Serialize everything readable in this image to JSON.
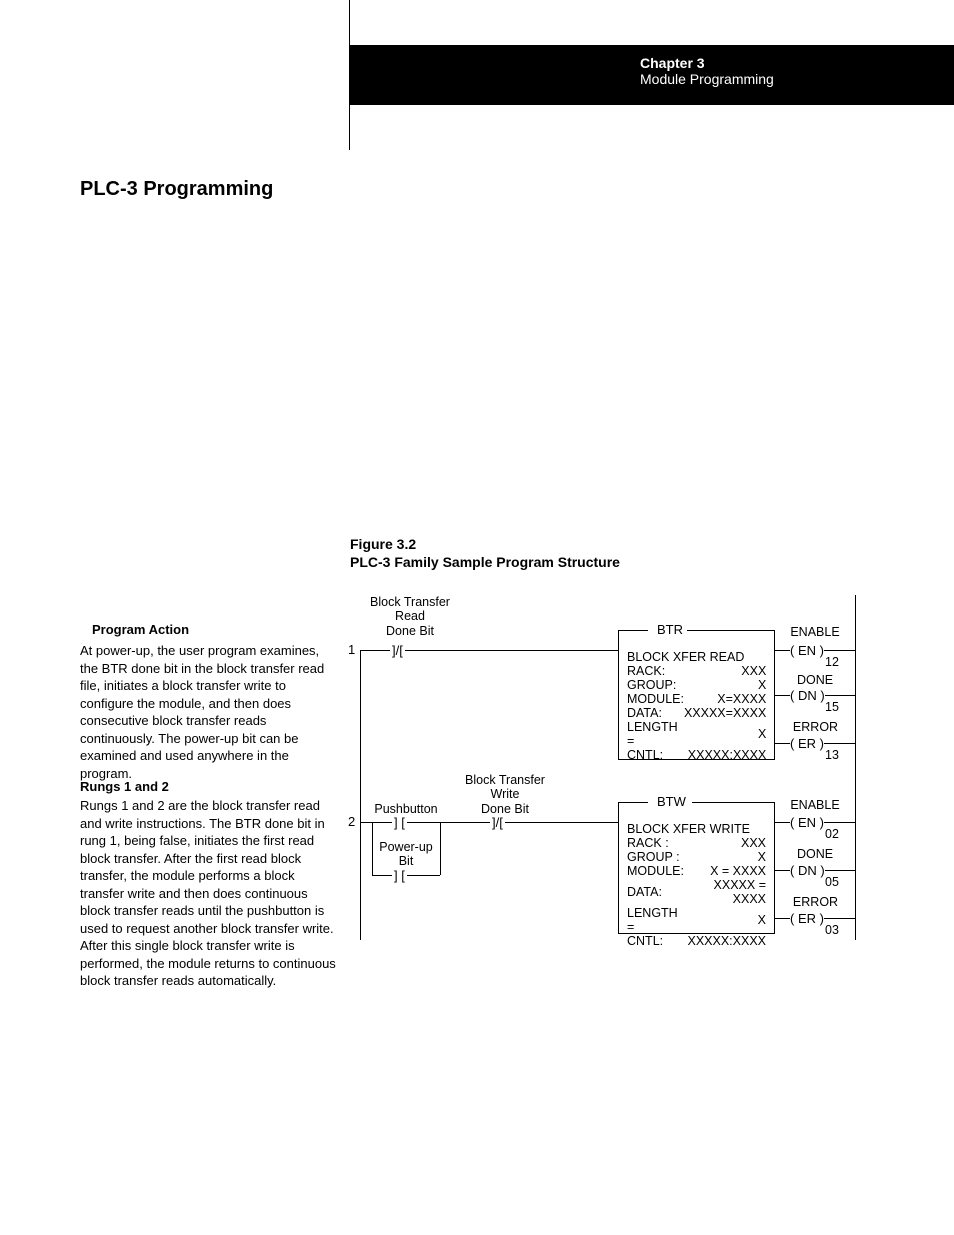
{
  "header": {
    "chapter": "Chapter 3",
    "subtitle": "Module Programming"
  },
  "heading": "PLC-3 Programming",
  "figure": {
    "num": "Figure 3.2",
    "title": "PLC-3 Family Sample Program Structure"
  },
  "left": {
    "h1": "Program Action",
    "p1": "At power-up, the user program examines, the BTR done bit in the block transfer read file, initiates a block transfer write to configure the module, and then does consecutive block transfer reads continuously.  The power-up bit can be examined and used anywhere in the program.",
    "h2": "Rungs 1 and 2",
    "p2": "Rungs 1 and 2 are the block transfer read and write instructions. The BTR done bit in rung 1, being false, initiates the first read block transfer. After the first read block transfer, the module performs a block transfer write and then does continuous block transfer reads until the pushbutton is used to request another block transfer write. After this single block transfer write is performed, the module returns to continuous block transfer reads automatically."
  },
  "ladder": {
    "rung1": {
      "num": "1",
      "contact1": "Block Transfer\nRead\nDone Bit",
      "boxTitle": "BTR",
      "boxH": "BLOCK XFER READ",
      "rows": [
        [
          "RACK:",
          "XXX"
        ],
        [
          "GROUP:",
          "X"
        ],
        [
          "MODULE:",
          "X=XXXX"
        ],
        [
          "DATA:",
          "XXXXX=XXXX"
        ],
        [
          "LENGTH  =",
          "X"
        ],
        [
          "CNTL:",
          "XXXXX:XXXX"
        ]
      ],
      "out": [
        [
          "ENABLE",
          "EN",
          "12"
        ],
        [
          "DONE",
          "DN",
          "15"
        ],
        [
          "ERROR",
          "ER",
          "13"
        ]
      ]
    },
    "rung2": {
      "num": "2",
      "pushbutton": "Pushbutton",
      "powerup": "Power-up\nBit",
      "contact1": "Block Transfer\nWrite\nDone Bit",
      "boxTitle": "BTW",
      "boxH": "BLOCK XFER WRITE",
      "rows": [
        [
          "RACK    :",
          "XXX"
        ],
        [
          "GROUP  :",
          "X"
        ],
        [
          "MODULE:",
          "X = XXXX"
        ],
        [
          "DATA:",
          "XXXXX = XXXX"
        ],
        [
          "LENGTH  =",
          "X"
        ],
        [
          "CNTL:",
          "XXXXX:XXXX"
        ]
      ],
      "out": [
        [
          "ENABLE",
          "EN",
          "02"
        ],
        [
          "DONE",
          "DN",
          "05"
        ],
        [
          "ERROR",
          "ER",
          "03"
        ]
      ]
    }
  }
}
